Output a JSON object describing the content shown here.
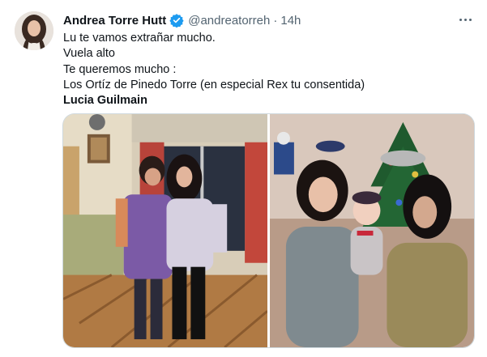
{
  "tweet": {
    "author_name": "Andrea Torre Hutt",
    "handle": "@andreatorreh",
    "separator": "·",
    "time": "14h",
    "verified": true,
    "lines": [
      "Lu te vamos extrañar mucho.",
      "Vuela alto",
      "Te queremos mucho :",
      "Los Ortíz de Pinedo Torre  (en especial Rex tu consentida)"
    ],
    "bold_line": "Lucia Guilmain",
    "media_count": 2
  },
  "icons": {
    "verified": "verified-badge-icon",
    "more": "more-options-icon"
  },
  "colors": {
    "accent": "#1d9bf0",
    "secondary_text": "#536471",
    "border": "#cfd9de"
  }
}
